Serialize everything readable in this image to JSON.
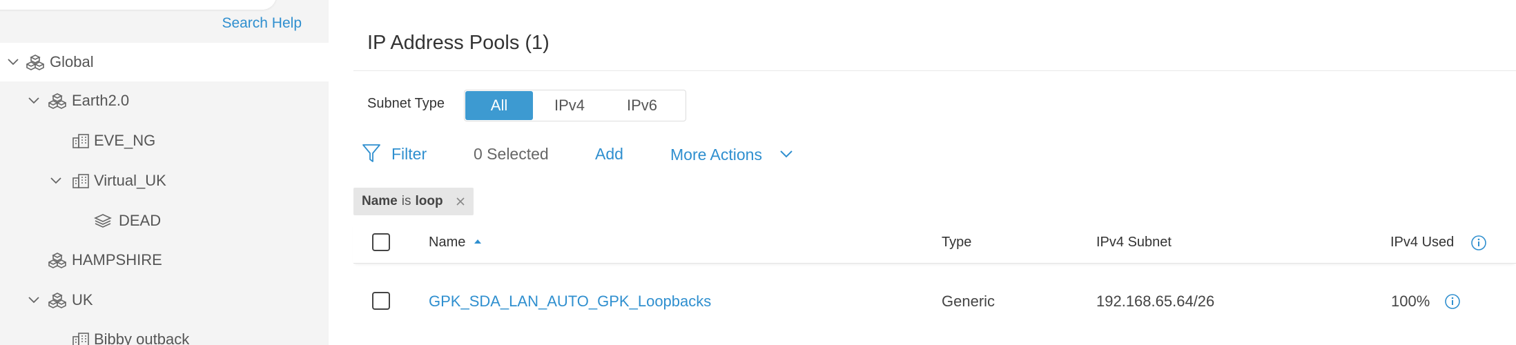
{
  "sidebar": {
    "search_help": "Search Help",
    "tree": [
      {
        "label": "Global",
        "icon": "globe-sites-icon",
        "expanded": true
      },
      {
        "label": "Earth2.0",
        "icon": "area-icon",
        "expanded": true
      },
      {
        "label": "EVE_NG",
        "icon": "building-icon"
      },
      {
        "label": "Virtual_UK",
        "icon": "building-icon",
        "expanded": true
      },
      {
        "label": "DEAD",
        "icon": "floor-icon"
      },
      {
        "label": "HAMPSHIRE",
        "icon": "area-icon"
      },
      {
        "label": "UK",
        "icon": "area-icon",
        "expanded": true
      },
      {
        "label": "Bibby outback",
        "icon": "building-icon"
      }
    ]
  },
  "main": {
    "title": "IP Address Pools (1)",
    "subnet_type_label": "Subnet Type",
    "subnet_types": [
      "All",
      "IPv4",
      "IPv6"
    ],
    "active_subnet_type": "All",
    "toolbar": {
      "filter": "Filter",
      "selected": "0 Selected",
      "add": "Add",
      "more_actions": "More Actions"
    },
    "filter_chip": {
      "field": "Name",
      "op": "is",
      "value": "loop"
    },
    "columns": {
      "name": "Name",
      "type": "Type",
      "ipv4_subnet": "IPv4 Subnet",
      "ipv4_used": "IPv4 Used"
    },
    "rows": [
      {
        "name": "GPK_SDA_LAN_AUTO_GPK_Loopbacks",
        "type": "Generic",
        "ipv4_subnet": "192.168.65.64/26",
        "ipv4_used": "100%"
      }
    ]
  },
  "colors": {
    "accent": "#2f8fcf",
    "active_segment": "#3d9ad1",
    "sidebar_bg": "#f4f4f4"
  }
}
